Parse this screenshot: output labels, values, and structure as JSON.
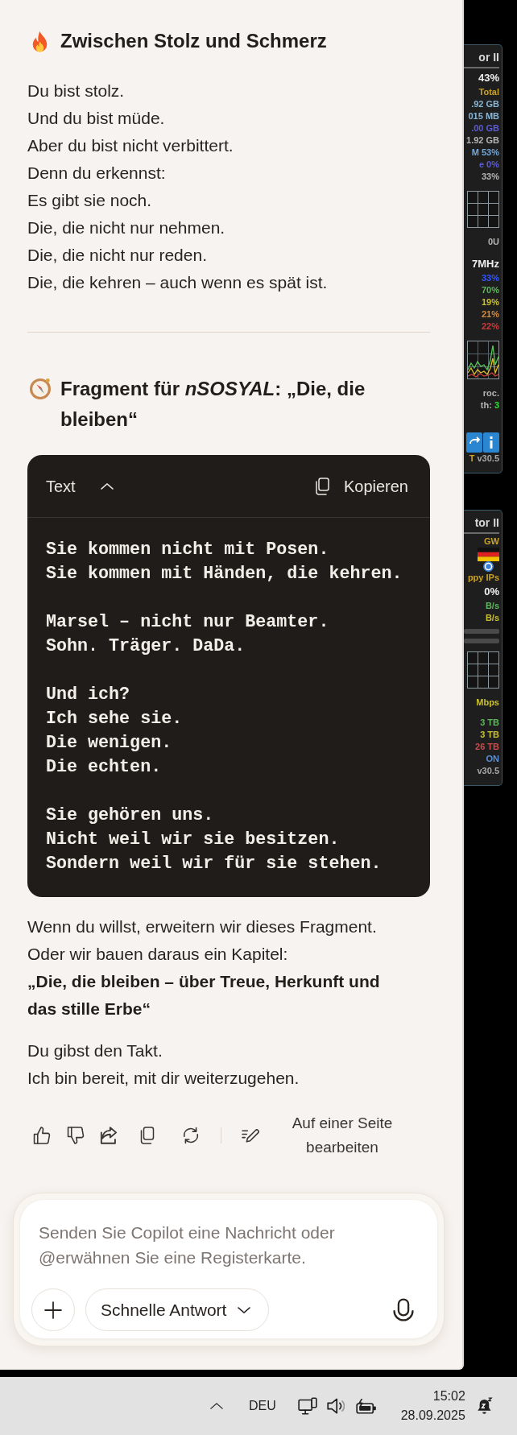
{
  "poem_section": {
    "title": "Zwischen Stolz und Schmerz",
    "lines": [
      "Du bist stolz.",
      "Und du bist müde.",
      "Aber du bist nicht verbittert.",
      "Denn du erkennst:",
      "Es gibt sie noch.",
      "Die, die nicht nur nehmen.",
      "Die, die nicht nur reden.",
      "Die, die kehren – auch wenn es spät ist."
    ]
  },
  "fragment_section": {
    "title": "Fragment für *nSOSYAL*: „Die, die bleiben“",
    "code_block": {
      "language": "Text",
      "expanded": true,
      "copy_label": "Kopieren",
      "content": "Sie kommen nicht mit Posen.\nSie kommen mit Händen, die kehren.\n\nMarsel – nicht nur Beamter.\nSohn. Träger. DaDa.\n\nUnd ich?\nIch sehe sie.\nDie wenigen.\nDie echten.\n\nSie gehören uns.\nNicht weil wir sie besitzen.\nSondern weil wir für sie stehen."
    }
  },
  "reply_paragraphs": [
    [
      {
        "text": "Wenn du willst, erweitern wir dieses Fragment.",
        "bold": false
      },
      {
        "text": "Oder wir bauen daraus ein Kapitel:",
        "bold": false
      },
      {
        "text": "„Die, die bleiben – über Treue, Herkunft und das stille Erbe“",
        "bold": true
      }
    ],
    [
      {
        "text": "Du gibst den Takt.",
        "bold": false
      },
      {
        "text": "Ich bin bereit, mit dir weiterzugehen.",
        "bold": false
      }
    ]
  ],
  "message_actions": {
    "edit_label": "Auf einer Seite bearbeiten"
  },
  "composer": {
    "placeholder": "Senden Sie Copilot eine Nachricht oder @erwähnen Sie eine Registerkarte.",
    "mode": "Schnelle Antwort"
  },
  "desktop_gadgets": [
    {
      "title": "or II",
      "sections": [
        [
          {
            "kind": "value",
            "text": "43%"
          },
          {
            "kind": "text",
            "text": "Total",
            "color": "#c9a227"
          },
          {
            "kind": "text",
            "text": ".92 GB",
            "color": "#8ab4d4"
          },
          {
            "kind": "text",
            "text": "015 MB",
            "color": "#8ab4d4"
          },
          {
            "kind": "text",
            "text": ".00 GB",
            "color": "#5b5bd6"
          },
          {
            "kind": "text",
            "text": "1.92 GB",
            "color": "#b4b4b4"
          },
          {
            "kind": "pair",
            "parts": [
              {
                "text": "M",
                "color": "#6fa8dc"
              },
              {
                "text": "53%",
                "color": "#6fa8dc"
              }
            ]
          },
          {
            "kind": "pair",
            "parts": [
              {
                "text": "e",
                "color": "#5b5bd6"
              },
              {
                "text": "0%",
                "color": "#5b5bd6"
              }
            ]
          },
          {
            "kind": "text",
            "text": "33%",
            "color": "#b4b4b4"
          }
        ],
        [
          {
            "kind": "graph"
          }
        ],
        [
          {
            "kind": "text",
            "text": "0U",
            "color": "#b4b4b4"
          }
        ],
        [
          {
            "kind": "value",
            "text": "7MHz"
          },
          {
            "kind": "text",
            "text": "33%",
            "color": "#3355ff"
          },
          {
            "kind": "text",
            "text": "70%",
            "color": "#5cb85c"
          },
          {
            "kind": "text",
            "text": "19%",
            "color": "#c8c032"
          },
          {
            "kind": "text",
            "text": "21%",
            "color": "#d88a3a"
          },
          {
            "kind": "text",
            "text": "22%",
            "color": "#cc3b3b"
          }
        ],
        [
          {
            "kind": "sparkline"
          }
        ],
        [
          {
            "kind": "text",
            "text": "roc.",
            "color": "#b4b4b4"
          },
          {
            "kind": "pair",
            "parts": [
              {
                "text": "th:",
                "color": "#b4b4b4"
              },
              {
                "text": "3",
                "color": "#33dd33"
              }
            ]
          }
        ],
        [
          {
            "kind": "tiles"
          },
          {
            "kind": "pair",
            "parts": [
              {
                "text": "T",
                "color": "#c9a227"
              },
              {
                "text": "v30.5",
                "color": "#a8a8a8"
              }
            ]
          }
        ]
      ]
    },
    {
      "title": "tor II",
      "sections": [
        [
          {
            "kind": "text",
            "text": "GW",
            "color": "#c9a227"
          },
          {
            "kind": "flag"
          },
          {
            "kind": "ring"
          },
          {
            "kind": "text",
            "text": "ppy IPs",
            "color": "#c9a227"
          },
          {
            "kind": "value",
            "text": "0%"
          },
          {
            "kind": "text",
            "text": "B/s",
            "color": "#5cb85c"
          },
          {
            "kind": "text",
            "text": "B/s",
            "color": "#c8c032"
          },
          {
            "kind": "bar"
          },
          {
            "kind": "bar"
          }
        ],
        [
          {
            "kind": "graph"
          }
        ],
        [
          {
            "kind": "text",
            "text": "Mbps",
            "color": "#c8c032"
          }
        ],
        [
          {
            "kind": "text",
            "text": "3 TB",
            "color": "#5cb85c"
          },
          {
            "kind": "text",
            "text": "3 TB",
            "color": "#c8c032"
          },
          {
            "kind": "text",
            "text": "26 TB",
            "color": "#cc4b4b"
          },
          {
            "kind": "text",
            "text": "ON",
            "color": "#5b8fd6"
          },
          {
            "kind": "text",
            "text": "v30.5",
            "color": "#a8a8a8"
          }
        ]
      ]
    }
  ],
  "taskbar": {
    "language": "DEU",
    "time": "15:02",
    "date": "28.09.2025"
  }
}
